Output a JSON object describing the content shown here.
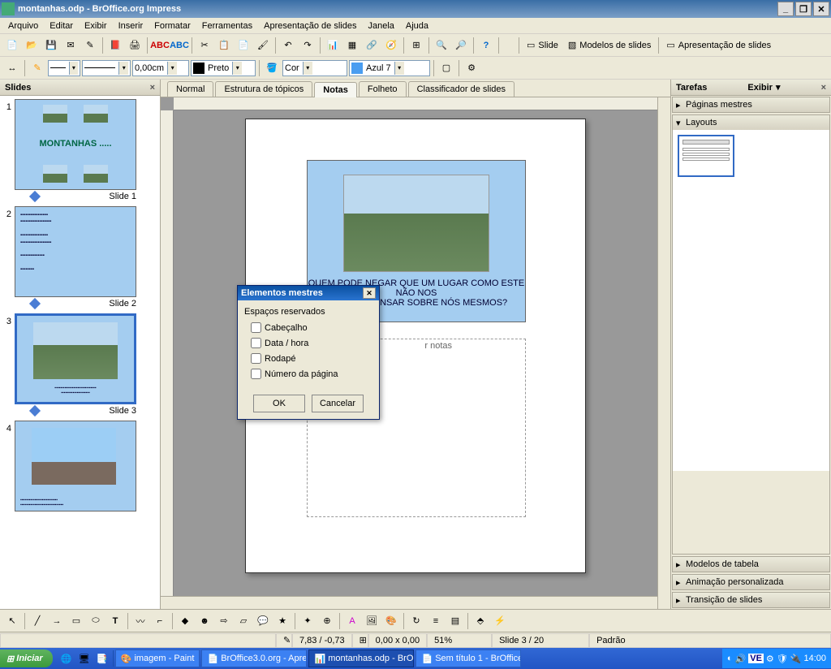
{
  "window": {
    "title": "montanhas.odp - BrOffice.org Impress",
    "min": "_",
    "max": "❐",
    "restore": "❐",
    "close": "✕"
  },
  "menu": {
    "arquivo": "Arquivo",
    "editar": "Editar",
    "exibir": "Exibir",
    "inserir": "Inserir",
    "formatar": "Formatar",
    "ferramentas": "Ferramentas",
    "apresentacao": "Apresentação de slides",
    "janela": "Janela",
    "ajuda": "Ajuda"
  },
  "toolbar_main": {
    "slide_btn": "Slide",
    "modelos_btn": "Modelos de slides",
    "apresentacao_btn": "Apresentação de slides"
  },
  "toolbar_line": {
    "width": "0,00cm",
    "color_label": "Preto",
    "fill_type": "Cor",
    "fill_value": "Azul 7"
  },
  "slides_panel": {
    "title": "Slides",
    "items": [
      {
        "label": "Slide 1",
        "title": "MONTANHAS ....."
      },
      {
        "label": "Slide 2"
      },
      {
        "label": "Slide 3"
      },
      {
        "label": ""
      }
    ]
  },
  "view_tabs": {
    "normal": "Normal",
    "estrutura": "Estrutura de tópicos",
    "notas": "Notas",
    "folheto": "Folheto",
    "classificador": "Classificador de slides"
  },
  "notes": {
    "slide_text_1": "QUEM PODE NEGAR QUE UM LUGAR COMO ESTE NÃO NOS",
    "slide_text_2": "ENSINA A PENSAR SOBRE NÓS MESMOS?",
    "placeholder_visible": "r notas"
  },
  "tasks_panel": {
    "title": "Tarefas",
    "exibir": "Exibir",
    "secs": {
      "paginas_mestres": "Páginas mestres",
      "layouts": "Layouts",
      "modelos_tabela": "Modelos de tabela",
      "animacao": "Animação personalizada",
      "transicao": "Transição de slides"
    }
  },
  "dialog": {
    "title": "Elementos mestres",
    "group": "Espaços reservados",
    "cabecalho": "Cabeçalho",
    "data_hora": "Data / hora",
    "rodape": "Rodapé",
    "numero_pagina": "Número da página",
    "ok": "OK",
    "cancelar": "Cancelar"
  },
  "statusbar": {
    "coords": "7,83 / -0,73",
    "size": "0,00 x 0,00",
    "zoom": "51%",
    "slide": "Slide 3 / 20",
    "padrao": "Padrão"
  },
  "taskbar": {
    "start": "Iniciar",
    "tasks": [
      "imagem - Paint",
      "BrOffice3.0.org - Apres...",
      "montanhas.odp - BrO...",
      "Sem título 1 - BrOffice.o..."
    ],
    "clock": "14:00"
  }
}
